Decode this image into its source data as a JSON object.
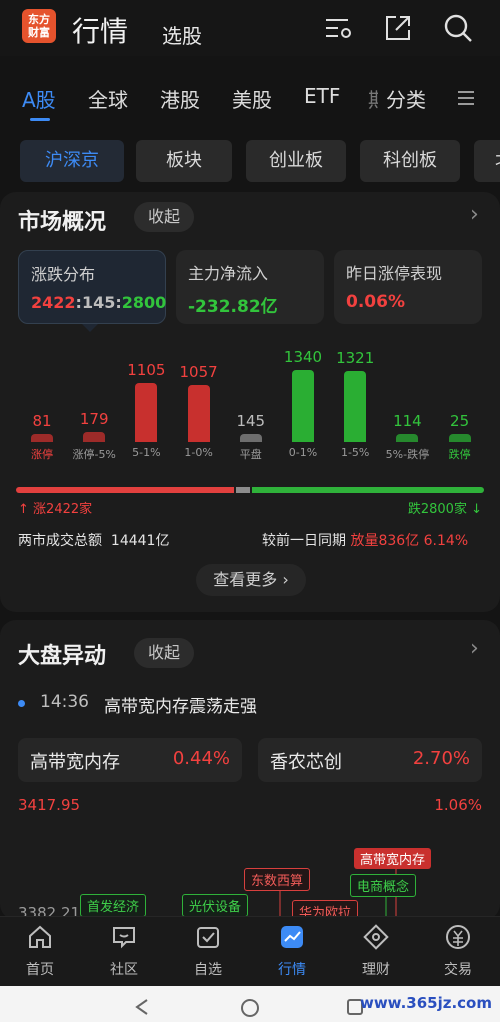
{
  "header": {
    "logo_text_1": "东方",
    "logo_text_2": "财富",
    "title": "行情",
    "subtitle": "选股",
    "icons": [
      "settings-list-icon",
      "share-icon",
      "search-icon"
    ]
  },
  "market_tabs": [
    "A股",
    "全球",
    "港股",
    "美股",
    "ETF",
    "期",
    "分类"
  ],
  "sub_tabs": [
    "沪深京",
    "板块",
    "创业板",
    "科创板",
    "北"
  ],
  "overview": {
    "title": "市场概况",
    "collapse_label": "收起",
    "cards": [
      {
        "label": "涨跌分布",
        "up": "2422",
        "flat": "145",
        "down": "2800",
        "sep": ":"
      },
      {
        "label": "主力净流入",
        "value": "-232.82亿"
      },
      {
        "label": "昨日涨停表现",
        "value": "0.06%"
      }
    ],
    "bars": [
      {
        "value": "81",
        "label": "涨停",
        "color": "red",
        "level": 81
      },
      {
        "value": "179",
        "label": "涨停-5%",
        "color": "red",
        "level": 179
      },
      {
        "value": "1105",
        "label": "5-1%",
        "color": "red",
        "level": 1105
      },
      {
        "value": "1057",
        "label": "1-0%",
        "color": "red",
        "level": 1057
      },
      {
        "value": "145",
        "label": "平盘",
        "color": "grey",
        "level": 145
      },
      {
        "value": "1340",
        "label": "0-1%",
        "color": "green",
        "level": 1340
      },
      {
        "value": "1321",
        "label": "1-5%",
        "color": "green",
        "level": 1321
      },
      {
        "value": "114",
        "label": "5%-跌停",
        "color": "green",
        "level": 114
      },
      {
        "value": "25",
        "label": "跌停",
        "color": "green",
        "level": 25
      }
    ],
    "up_label": "涨2422家",
    "down_label": "跌2800家",
    "up_share": 0.4648,
    "turnover_label": "两市成交总额",
    "turnover_value": "14441亿",
    "compare_label": "较前一日同期",
    "compare_value": "放量836亿",
    "compare_pct": "6.14%",
    "more_label": "查看更多 ›"
  },
  "movement": {
    "title": "大盘异动",
    "collapse_label": "收起",
    "news_time": "14:36",
    "news_text": "高带宽内存震荡走强",
    "sectors": [
      {
        "name": "高带宽内存",
        "pct": "0.44%"
      },
      {
        "name": "香农芯创",
        "pct": "2.70%"
      }
    ],
    "index_high": "3417.95",
    "index_pct": "1.06%",
    "index_low": "3382.21",
    "tags": [
      "高带宽内存",
      "电商概念",
      "东数西算",
      "华为欧拉",
      "首发经济",
      "光伏设备"
    ]
  },
  "bottom_nav": [
    {
      "label": "首页",
      "icon": "home-icon"
    },
    {
      "label": "社区",
      "icon": "community-icon"
    },
    {
      "label": "自选",
      "icon": "watchlist-icon"
    },
    {
      "label": "行情",
      "icon": "market-icon"
    },
    {
      "label": "理财",
      "icon": "wealth-icon"
    },
    {
      "label": "交易",
      "icon": "trade-icon"
    }
  ],
  "watermark": "www.365jz.com"
}
